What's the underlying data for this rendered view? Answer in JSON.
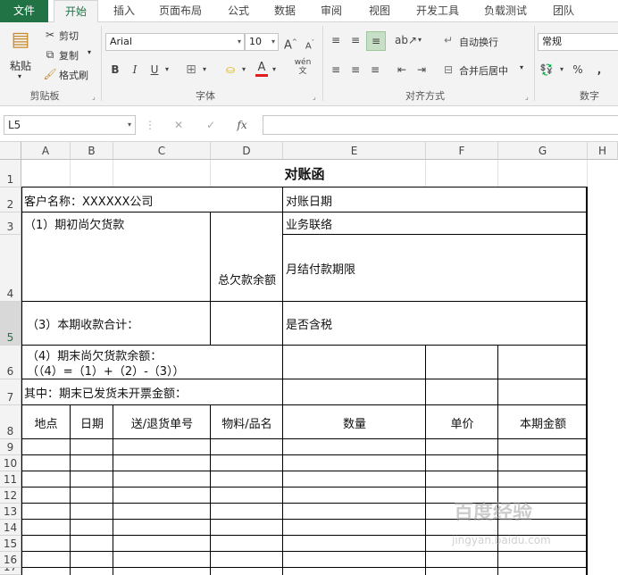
{
  "tabs": [
    "文件",
    "开始",
    "插入",
    "页面布局",
    "公式",
    "数据",
    "审阅",
    "视图",
    "开发工具",
    "负载测试",
    "团队"
  ],
  "ribbon": {
    "clipboard": {
      "paste": "粘贴",
      "cut": "剪切",
      "copy": "复制",
      "format_painter": "格式刷",
      "label": "剪贴板"
    },
    "font": {
      "name": "Arial",
      "size": "10",
      "bold": "B",
      "italic": "I",
      "underline": "U",
      "label": "字体",
      "grow": "A",
      "shrink": "A",
      "wen": "wén",
      "font_color_accent": "#e01e1e"
    },
    "alignment": {
      "wrap": "自动换行",
      "merge": "合并后居中",
      "label": "对齐方式"
    },
    "number": {
      "format": "常规",
      "percent": "%",
      "comma": ",",
      "label": "数字"
    }
  },
  "formula_bar": {
    "name_box": "L5",
    "fx": "fx",
    "cancel": "✕",
    "enter": "✓"
  },
  "columns": [
    "A",
    "B",
    "C",
    "D",
    "E",
    "F",
    "G",
    "H"
  ],
  "rows": [
    "1",
    "2",
    "3",
    "4",
    "5",
    "6",
    "7",
    "8",
    "9",
    "10",
    "11",
    "12",
    "13",
    "14",
    "15",
    "16",
    "17"
  ],
  "sheet": {
    "title": "对账函",
    "customer": "客户名称：XXXXXX公司",
    "statement_date": "对账日期",
    "opening_balance": "（1）期初尚欠货款",
    "total_due": "总欠款余额",
    "business_contact": "业务联络",
    "payment_terms": "月结付款期限",
    "receipts_total": "（3）本期收款合计：",
    "tax_included": "是否含税",
    "closing_balance": "（4）期末尚欠货款余额：",
    "closing_formula": "（（4）=（1）+（2）-（3））",
    "uninvoiced": "其中：期末已发货未开票金额：",
    "headers": [
      "地点",
      "日期",
      "送/退货单号",
      "物料/品名",
      "数量",
      "单价",
      "本期金额"
    ]
  },
  "watermark": {
    "main": "百度经验",
    "sub": "jingyan.baidu.com"
  }
}
